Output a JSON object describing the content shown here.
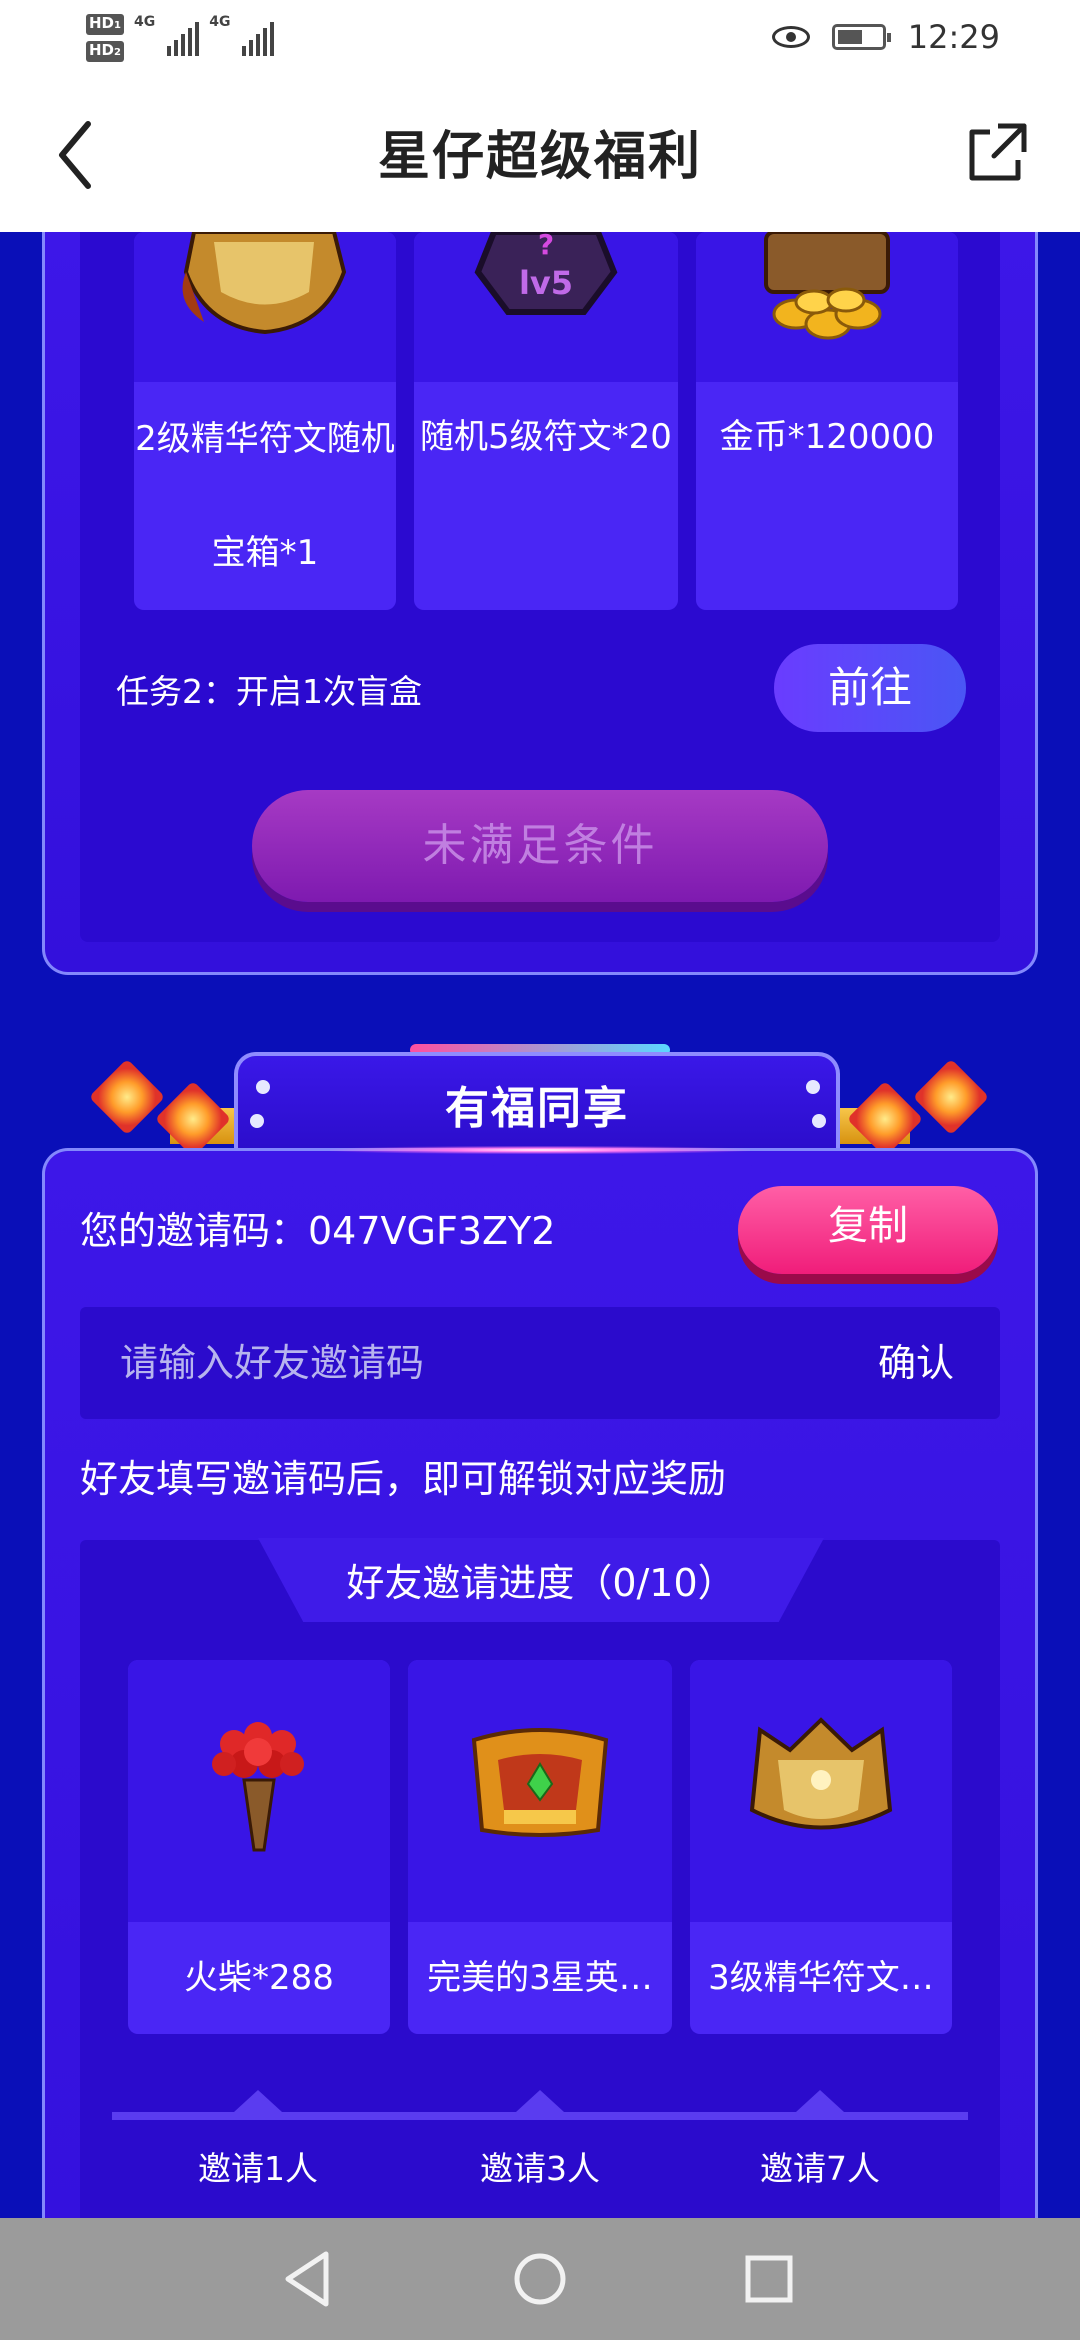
{
  "status_bar": {
    "hd1": "HD",
    "hd1_sub": "1",
    "hd2": "HD",
    "hd2_sub": "2",
    "net1": "4G",
    "net2": "4G",
    "time": "12:29"
  },
  "title_bar": {
    "title": "星仔超级福利"
  },
  "task_section": {
    "rewards": [
      {
        "label": "2级精华符文随机宝箱*1",
        "icon": "golden-crown-chest-icon"
      },
      {
        "label": "随机5级符文*20",
        "icon": "lv5-rune-icon"
      },
      {
        "label": "金币*120000",
        "icon": "gold-coins-chest-icon"
      }
    ],
    "task_text": "任务2：开启1次盲盒",
    "goto_label": "前往",
    "claim_label": "未满足条件"
  },
  "share_section": {
    "title": "有福同享",
    "invite_code_label": "您的邀请码：047VGF3ZY2",
    "copy_label": "复制",
    "input_placeholder": "请输入好友邀请码",
    "confirm_label": "确认",
    "hint": "好友填写邀请码后，即可解锁对应奖励",
    "progress_title": "好友邀请进度（0/10）",
    "rewards": [
      {
        "label": "火柴*288",
        "icon": "match-bundle-icon"
      },
      {
        "label": "完美的3星英…",
        "icon": "hero-chest-icon"
      },
      {
        "label": "3级精华符文…",
        "icon": "golden-crown-chest-icon"
      }
    ],
    "steps": [
      "邀请1人",
      "邀请3人",
      "邀请7人"
    ]
  },
  "colors": {
    "background": "#0a0fb8",
    "panel": "#3d17e8",
    "pink_button": "#f01d7a",
    "purple_button": "#7e1ab0"
  }
}
